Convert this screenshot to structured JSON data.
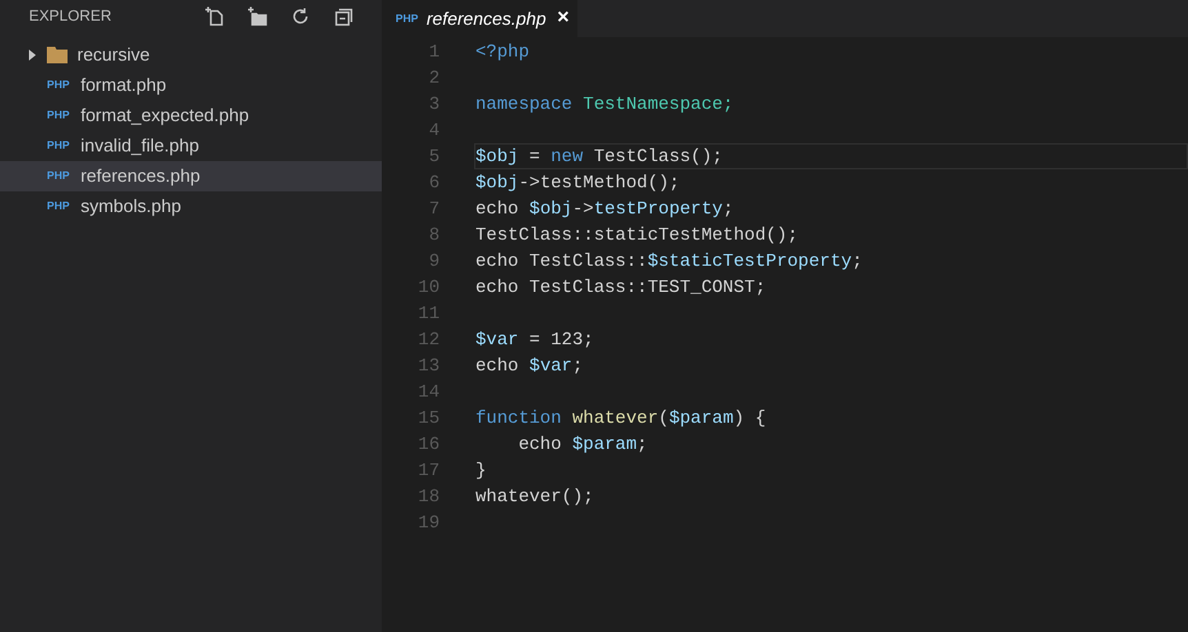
{
  "sidebar": {
    "title": "EXPLORER",
    "items": [
      {
        "kind": "folder",
        "label": "recursive",
        "expanded": false,
        "selected": false
      },
      {
        "kind": "file",
        "badge": "PHP",
        "label": "format.php",
        "selected": false
      },
      {
        "kind": "file",
        "badge": "PHP",
        "label": "format_expected.php",
        "selected": false
      },
      {
        "kind": "file",
        "badge": "PHP",
        "label": "invalid_file.php",
        "selected": false
      },
      {
        "kind": "file",
        "badge": "PHP",
        "label": "references.php",
        "selected": true
      },
      {
        "kind": "file",
        "badge": "PHP",
        "label": "symbols.php",
        "selected": false
      }
    ]
  },
  "tabs": [
    {
      "badge": "PHP",
      "label": "references.php",
      "close": "×",
      "selected": true
    }
  ],
  "editor": {
    "lines": [
      {
        "number": "1",
        "current": false,
        "tokens": [
          {
            "text": "<?php",
            "kind": "keyword"
          }
        ]
      },
      {
        "number": "2",
        "current": false
      },
      {
        "number": "3",
        "current": false,
        "tokens": [
          {
            "text": "namespace",
            "kind": "keyword"
          },
          {
            "text": " TestNamespace;",
            "kind": "type"
          }
        ]
      },
      {
        "number": "4",
        "current": false
      },
      {
        "number": "5",
        "current": true,
        "tokens": [
          {
            "text": "$obj",
            "kind": "variable"
          },
          {
            "text": " = ",
            "kind": "plain"
          },
          {
            "text": "new",
            "kind": "keyword"
          },
          {
            "text": " TestClass();",
            "kind": "plain"
          }
        ]
      },
      {
        "number": "6",
        "current": false,
        "tokens": [
          {
            "text": "$obj",
            "kind": "variable"
          },
          {
            "text": "->testMethod();",
            "kind": "plain"
          }
        ]
      },
      {
        "number": "7",
        "current": false,
        "tokens": [
          {
            "text": "echo ",
            "kind": "plain"
          },
          {
            "text": "$obj",
            "kind": "variable"
          },
          {
            "text": "->",
            "kind": "plain"
          },
          {
            "text": "testProperty",
            "kind": "variable"
          },
          {
            "text": ";",
            "kind": "plain"
          }
        ]
      },
      {
        "number": "8",
        "current": false,
        "tokens": [
          {
            "text": "TestClass::staticTestMethod();",
            "kind": "plain"
          }
        ]
      },
      {
        "number": "9",
        "current": false,
        "tokens": [
          {
            "text": "echo TestClass::",
            "kind": "plain"
          },
          {
            "text": "$staticTestProperty",
            "kind": "variable"
          },
          {
            "text": ";",
            "kind": "plain"
          }
        ]
      },
      {
        "number": "10",
        "current": false,
        "tokens": [
          {
            "text": "echo TestClass::TEST_CONST;",
            "kind": "plain"
          }
        ]
      },
      {
        "number": "11",
        "current": false
      },
      {
        "number": "12",
        "current": false,
        "tokens": [
          {
            "text": "$var",
            "kind": "variable"
          },
          {
            "text": " = 123;",
            "kind": "plain"
          }
        ]
      },
      {
        "number": "13",
        "current": false,
        "tokens": [
          {
            "text": "echo ",
            "kind": "plain"
          },
          {
            "text": "$var",
            "kind": "variable"
          },
          {
            "text": ";",
            "kind": "plain"
          }
        ]
      },
      {
        "number": "14",
        "current": false
      },
      {
        "number": "15",
        "current": false,
        "tokens": [
          {
            "text": "function",
            "kind": "keyword"
          },
          {
            "text": " whatever",
            "kind": "function"
          },
          {
            "text": "(",
            "kind": "plain"
          },
          {
            "text": "$param",
            "kind": "variable"
          },
          {
            "text": ") {",
            "kind": "plain"
          }
        ]
      },
      {
        "number": "16",
        "current": false,
        "tokens": [
          {
            "text": "    echo ",
            "kind": "plain"
          },
          {
            "text": "$param",
            "kind": "variable"
          },
          {
            "text": ";",
            "kind": "plain"
          }
        ]
      },
      {
        "number": "17",
        "current": false,
        "tokens": [
          {
            "text": "}",
            "kind": "plain"
          }
        ]
      },
      {
        "number": "18",
        "current": false,
        "tokens": [
          {
            "text": "whatever();",
            "kind": "plain"
          }
        ]
      },
      {
        "number": "19",
        "current": false
      }
    ]
  }
}
